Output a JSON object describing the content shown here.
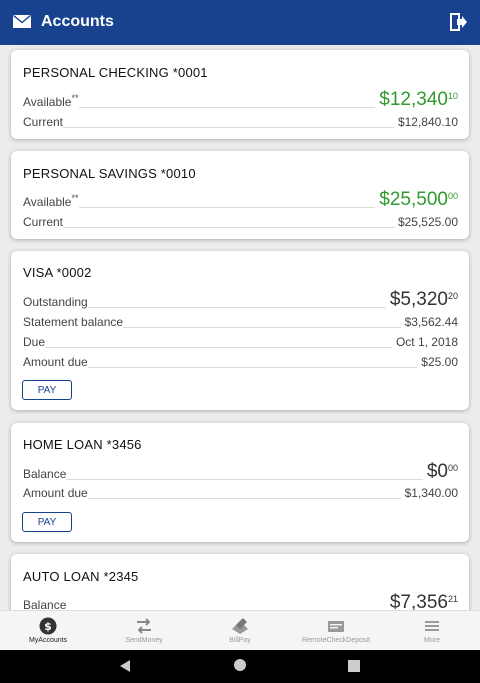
{
  "header": {
    "title": "Accounts",
    "colors": {
      "bar": "#18418e"
    }
  },
  "accounts": [
    {
      "name": "PERSONAL CHECKING *0001",
      "rows": [
        {
          "label": "Available",
          "sup": "**",
          "value_main": "$12,340",
          "value_cents": "10",
          "style": "big-green"
        },
        {
          "label": "Current",
          "value": "$12,840.10"
        }
      ]
    },
    {
      "name": "PERSONAL SAVINGS *0010",
      "rows": [
        {
          "label": "Available",
          "sup": "**",
          "value_main": "$25,500",
          "value_cents": "00",
          "style": "big-green"
        },
        {
          "label": "Current",
          "value": "$25,525.00"
        }
      ]
    },
    {
      "name": "VISA *0002",
      "rows": [
        {
          "label": "Outstanding",
          "value_main": "$5,320",
          "value_cents": "20",
          "style": "big"
        },
        {
          "label": "Statement balance",
          "value": "$3,562.44"
        },
        {
          "label": "Due",
          "value": "Oct 1, 2018"
        },
        {
          "label": "Amount due",
          "value": "$25.00"
        }
      ],
      "pay_label": "PAY"
    },
    {
      "name": "HOME LOAN *3456",
      "rows": [
        {
          "label": "Balance",
          "value_main": "$0",
          "value_cents": "00",
          "style": "big"
        },
        {
          "label": "Amount due",
          "value": "$1,340.00"
        }
      ],
      "pay_label": "PAY"
    },
    {
      "name": "AUTO LOAN *2345",
      "rows": [
        {
          "label": "Balance",
          "value_main": "$7,356",
          "value_cents": "21",
          "style": "big"
        }
      ]
    }
  ],
  "tabs": [
    {
      "label": "MyAccounts",
      "icon": "dollar-circle-icon",
      "active": true
    },
    {
      "label": "SendMoney",
      "icon": "transfer-arrows-icon"
    },
    {
      "label": "BillPay",
      "icon": "bill-icon"
    },
    {
      "label": "RemoteCheckDeposit",
      "icon": "check-icon"
    },
    {
      "label": "More",
      "icon": "menu-icon"
    }
  ]
}
